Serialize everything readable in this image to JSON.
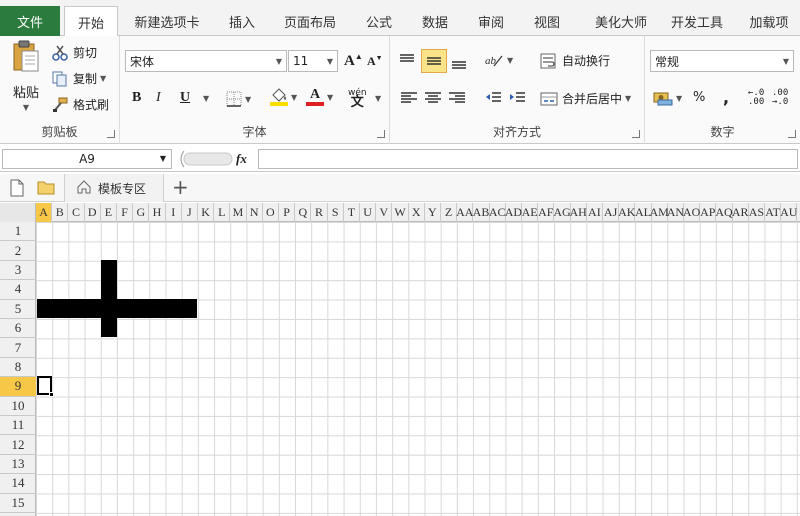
{
  "tabs": {
    "file": "文件",
    "items": [
      "开始",
      "新建选项卡",
      "插入",
      "页面布局",
      "公式",
      "数据",
      "审阅",
      "视图",
      "美化大师",
      "开发工具",
      "加载项"
    ],
    "active_index": 0
  },
  "clipboard": {
    "paste": "粘贴",
    "cut": "剪切",
    "copy": "复制",
    "format_painter": "格式刷",
    "label": "剪贴板"
  },
  "font": {
    "name": "宋体",
    "size": "11",
    "bold": "B",
    "italic": "I",
    "underline": "U",
    "font_color_glyph": "A",
    "phonetic_glyph": "wén",
    "label": "字体",
    "fill_color": "#f7e000",
    "font_color": "#e02020"
  },
  "alignment": {
    "wrap_text": "自动换行",
    "merge_center": "合并后居中",
    "label": "对齐方式"
  },
  "number": {
    "format": "常规",
    "percent": "%",
    "comma": ",",
    "increase_decimal": "←.0\n.00",
    "decrease_decimal": ".00\n→.0",
    "label": "数字"
  },
  "formula_bar": {
    "name_box": "A9",
    "fx": "fx",
    "value": ""
  },
  "doc_tabs": {
    "template_zone": "模板专区",
    "add": "+"
  },
  "grid": {
    "columns": [
      "A",
      "B",
      "C",
      "D",
      "E",
      "F",
      "G",
      "H",
      "I",
      "J",
      "K",
      "L",
      "M",
      "N",
      "O",
      "P",
      "Q",
      "R",
      "S",
      "T",
      "U",
      "V",
      "W",
      "X",
      "Y",
      "Z",
      "AA",
      "AB",
      "AC",
      "AD",
      "AE",
      "AF",
      "AG",
      "AH",
      "AI",
      "AJ",
      "AK",
      "AL",
      "AM",
      "AN",
      "AO",
      "AP",
      "AQ",
      "AR",
      "AS",
      "AT",
      "AU"
    ],
    "rows": [
      "1",
      "2",
      "3",
      "4",
      "5",
      "6",
      "7",
      "8",
      "9",
      "10",
      "11",
      "12",
      "13",
      "14",
      "15"
    ],
    "selected_column": "A",
    "selected_row": "9",
    "active_cell": "A9"
  },
  "colors": {
    "file_tab": "#2b7a3e",
    "selection_highlight": "#f7c847",
    "highlight_button": "#fbe38a"
  }
}
